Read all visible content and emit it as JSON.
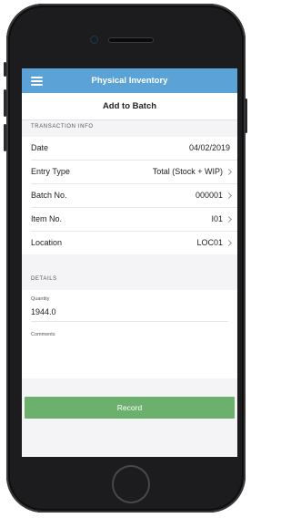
{
  "navbar": {
    "title": "Physical Inventory",
    "menu_icon": "hamburger-menu-icon"
  },
  "subheader": {
    "title": "Add to Batch"
  },
  "transaction_info": {
    "section_title": "TRANSACTION INFO",
    "rows": [
      {
        "label": "Date",
        "value": "04/02/2019",
        "chevron": false
      },
      {
        "label": "Entry Type",
        "value": "Total (Stock + WIP)",
        "chevron": true
      },
      {
        "label": "Batch No.",
        "value": "000001",
        "chevron": true
      },
      {
        "label": "Item No.",
        "value": "I01",
        "chevron": true
      },
      {
        "label": "Location",
        "value": "LOC01",
        "chevron": true
      }
    ]
  },
  "details": {
    "section_title": "DETAILS",
    "quantity_label": "Quantity",
    "quantity_value": "1944.0",
    "comments_label": "Comments",
    "comments_value": ""
  },
  "record_button": {
    "label": "Record",
    "color": "#6cb06e"
  },
  "colors": {
    "navbar": "#5ba3d6",
    "background": "#f4f4f6"
  }
}
